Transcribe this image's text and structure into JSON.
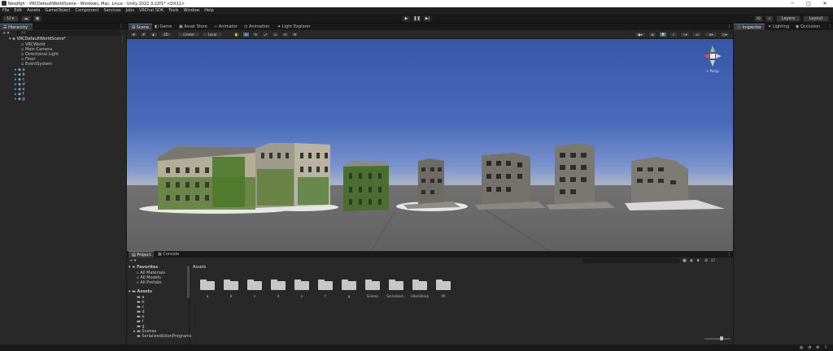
{
  "window": {
    "title": "Nesdfgh - VRCDefaultWorldScene - Windows, Mac, Linux - Unity 2022.3.22f1* <DX11>",
    "minimize": "─",
    "maximize": "□",
    "close": "✕"
  },
  "menu": [
    "File",
    "Edit",
    "Assets",
    "GameObject",
    "Component",
    "Services",
    "Jobs",
    "VRChat SDK",
    "Tools",
    "Window",
    "Help"
  ],
  "toolbar": {
    "account": "LI ▾",
    "layers": "Layers",
    "layout": "Layout"
  },
  "hierarchy": {
    "tab": "Hierarchy",
    "search_placeholder": "All",
    "scene": "VRCDefaultWorldScene*",
    "items": [
      "VRCWorld",
      "Main Camera",
      "Directional Light",
      "Floor",
      "EventSystem"
    ],
    "prefabs": [
      "a",
      "b",
      "c",
      "d",
      "e",
      "f",
      "g"
    ]
  },
  "scene_tabs": [
    "Scene",
    "Game",
    "Asset Store",
    "Animator",
    "Animation",
    "Light Explorer"
  ],
  "scene_toolbar": {
    "shading": "2D",
    "pivot": "Center",
    "space": "Local"
  },
  "gizmo": {
    "label": "< Persp"
  },
  "project": {
    "tabs": [
      "Project",
      "Console"
    ],
    "favorites_label": "Favorites",
    "favorites": [
      "All Materials",
      "All Models",
      "All Prefabs"
    ],
    "assets_label": "Assets",
    "tree": [
      "a",
      "b",
      "c",
      "d",
      "e",
      "f",
      "g",
      "Scenes",
      "SerializedUdonPrograms"
    ],
    "breadcrumb": "Assets",
    "folders": [
      "a",
      "b",
      "c",
      "d",
      "e",
      "f",
      "g",
      "Scenes",
      "Serialized...",
      "UdonSharp",
      "VR"
    ],
    "hidden_count": "27"
  },
  "inspector": {
    "tabs": [
      "Inspector",
      "Lighting",
      "Occlusion"
    ]
  },
  "colors": {
    "accent": "#3a79bb",
    "panel": "#282828",
    "sky_top": "#3756a8",
    "ground": "#616161"
  }
}
